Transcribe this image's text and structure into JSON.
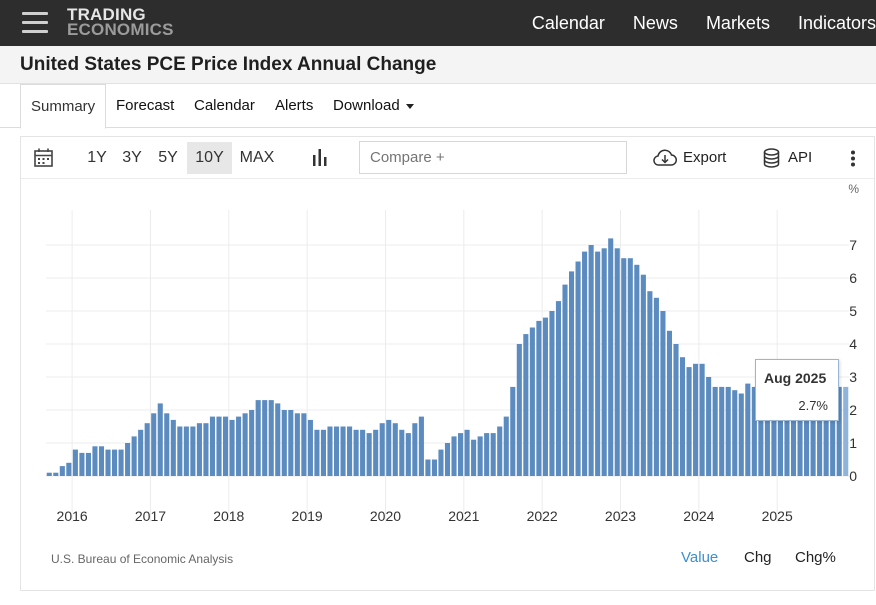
{
  "topbar": {
    "logo_line1": "TRADING",
    "logo_line2": "ECONOMICS",
    "nav": [
      "Calendar",
      "News",
      "Markets",
      "Indicators"
    ]
  },
  "page": {
    "title": "United States PCE Price Index Annual Change"
  },
  "tabs": {
    "summary": "Summary",
    "forecast": "Forecast",
    "calendar": "Calendar",
    "alerts": "Alerts",
    "download": "Download"
  },
  "toolbar": {
    "ranges": [
      "1Y",
      "3Y",
      "5Y",
      "10Y",
      "MAX"
    ],
    "selected_range": "10Y",
    "compare_placeholder": "Compare +",
    "export_label": "Export",
    "api_label": "API"
  },
  "footer": {
    "source": "U.S. Bureau of Economic Analysis",
    "value_label": "Value",
    "chg_label": "Chg",
    "chgpct_label": "Chg%"
  },
  "tooltip": {
    "date": "Aug 2025",
    "value": "2.7%"
  },
  "colors": {
    "bar": "#5b8bbf",
    "bar_highlight": "#8fb3da",
    "topbar_bg": "#2d2d2d",
    "active_footer": "#3d8fd0"
  },
  "chart_data": {
    "type": "bar",
    "unit": "%",
    "y_ticks": [
      0,
      1,
      2,
      3,
      4,
      5,
      6,
      7
    ],
    "ylim": [
      -0.1,
      7.5
    ],
    "x_ticks": [
      "2016",
      "2017",
      "2018",
      "2019",
      "2020",
      "2021",
      "2022",
      "2023",
      "2024",
      "2025"
    ],
    "start": "2015-09",
    "end": "2025-08",
    "values": [
      0.1,
      0.1,
      0.3,
      0.4,
      0.8,
      0.7,
      0.7,
      0.9,
      0.9,
      0.8,
      0.8,
      0.8,
      1.0,
      1.2,
      1.4,
      1.6,
      1.9,
      2.2,
      1.9,
      1.7,
      1.5,
      1.5,
      1.5,
      1.6,
      1.6,
      1.8,
      1.8,
      1.8,
      1.7,
      1.8,
      1.9,
      2.0,
      2.3,
      2.3,
      2.3,
      2.2,
      2.0,
      2.0,
      1.9,
      1.9,
      1.7,
      1.4,
      1.4,
      1.5,
      1.5,
      1.5,
      1.5,
      1.4,
      1.4,
      1.3,
      1.4,
      1.6,
      1.7,
      1.6,
      1.4,
      1.3,
      1.6,
      1.8,
      0.5,
      0.5,
      0.8,
      1.0,
      1.2,
      1.3,
      1.4,
      1.1,
      1.2,
      1.3,
      1.3,
      1.5,
      1.8,
      2.7,
      4.0,
      4.3,
      4.5,
      4.7,
      4.8,
      5.0,
      5.3,
      5.8,
      6.2,
      6.5,
      6.8,
      7.0,
      6.8,
      6.9,
      7.2,
      6.9,
      6.6,
      6.6,
      6.4,
      6.1,
      5.6,
      5.4,
      5.0,
      4.4,
      4.0,
      3.6,
      3.3,
      3.4,
      3.4,
      3.0,
      2.7,
      2.7,
      2.7,
      2.6,
      2.5,
      2.8,
      2.7,
      2.6,
      2.5,
      2.3,
      2.1,
      2.3,
      2.4,
      2.6,
      2.6,
      2.6,
      2.3,
      2.4,
      2.6,
      2.7,
      2.7
    ]
  }
}
